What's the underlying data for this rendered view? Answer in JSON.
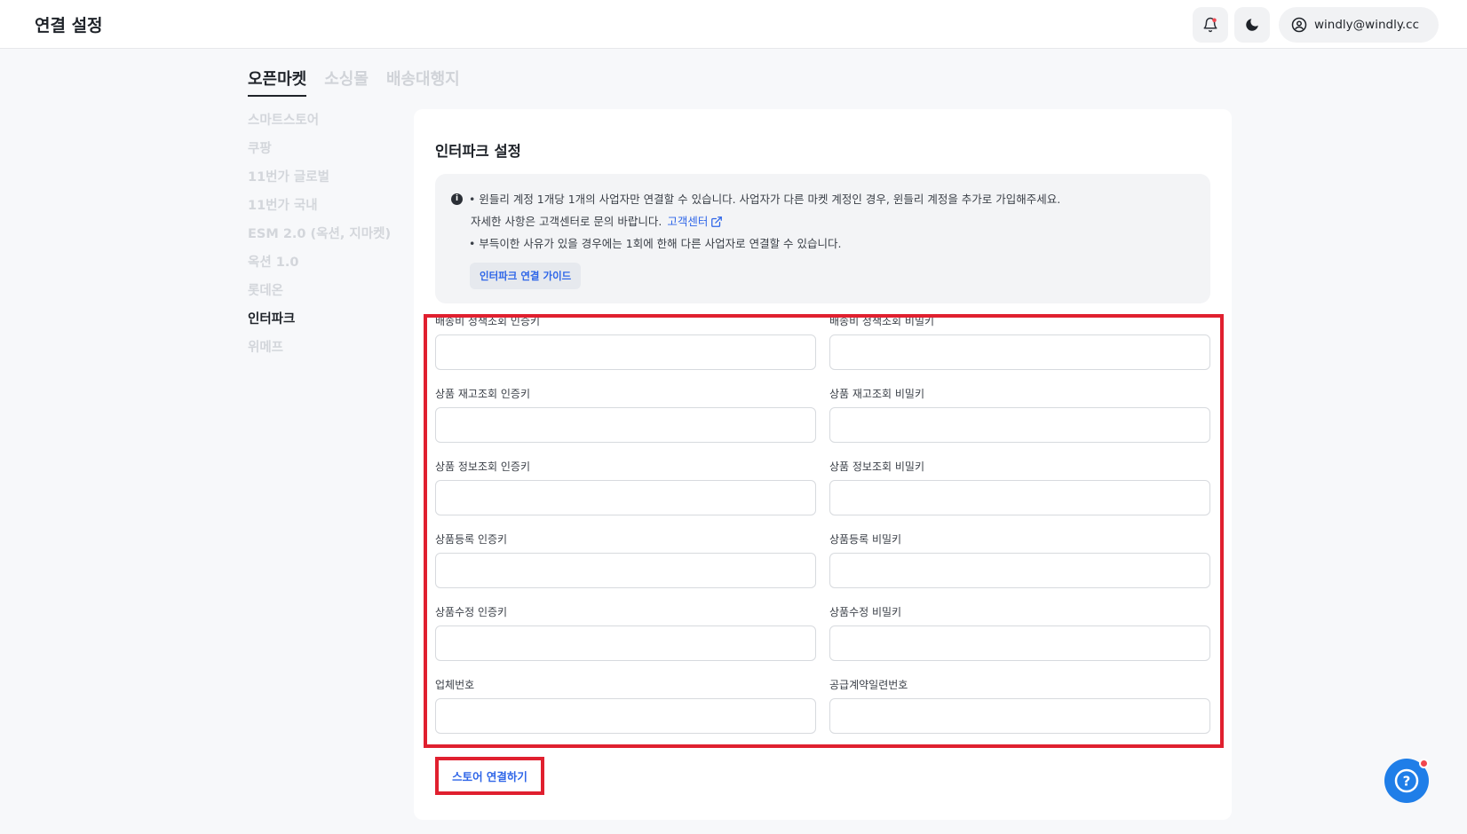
{
  "header": {
    "title": "연결 설정",
    "user_email": "windly@windly.cc"
  },
  "tabs": [
    {
      "label": "오픈마켓",
      "active": true
    },
    {
      "label": "소싱몰",
      "active": false
    },
    {
      "label": "배송대행지",
      "active": false
    }
  ],
  "sidebar": {
    "items": [
      {
        "label": "스마트스토어",
        "active": false
      },
      {
        "label": "쿠팡",
        "active": false
      },
      {
        "label": "11번가 글로벌",
        "active": false
      },
      {
        "label": "11번가 국내",
        "active": false
      },
      {
        "label": "ESM 2.0 (옥션, 지마켓)",
        "active": false
      },
      {
        "label": "옥션 1.0",
        "active": false
      },
      {
        "label": "롯데온",
        "active": false
      },
      {
        "label": "인터파크",
        "active": true
      },
      {
        "label": "위메프",
        "active": false
      }
    ]
  },
  "main": {
    "title": "인터파크 설정",
    "info": {
      "line1": "• 윈들리 계정 1개당 1개의 사업자만 연결할 수 있습니다. 사업자가 다른 마켓 계정인 경우, 윈들리 계정을 추가로 가입해주세요.",
      "line2": "자세한 사항은 고객센터로 문의 바랍니다.",
      "link": "고객센터",
      "line3": "• 부득이한 사유가 있을 경우에는 1회에 한해 다른 사업자로 연결할 수 있습니다.",
      "guide_button": "인터파크 연결 가이드"
    },
    "fields": [
      {
        "label": "배송비 정책조회 인증키",
        "value": ""
      },
      {
        "label": "배송비 정책조회 비밀키",
        "value": ""
      },
      {
        "label": "상품 재고조회 인증키",
        "value": ""
      },
      {
        "label": "상품 재고조회 비밀키",
        "value": ""
      },
      {
        "label": "상품 정보조회 인증키",
        "value": ""
      },
      {
        "label": "상품 정보조회 비밀키",
        "value": ""
      },
      {
        "label": "상품등록 인증키",
        "value": ""
      },
      {
        "label": "상품등록 비밀키",
        "value": ""
      },
      {
        "label": "상품수정 인증키",
        "value": ""
      },
      {
        "label": "상품수정 비밀키",
        "value": ""
      },
      {
        "label": "업체번호",
        "value": ""
      },
      {
        "label": "공급계약일련번호",
        "value": ""
      }
    ],
    "connect_button": "스토어 연결하기"
  },
  "colors": {
    "accent": "#2f66e8",
    "highlight": "#e0202f",
    "help_fab": "#1f7ee8"
  },
  "icons": {
    "bell": "bell-icon",
    "theme": "moon-icon",
    "user": "user-circle-icon",
    "info": "info-icon",
    "external": "external-link-icon",
    "help": "question-icon"
  }
}
